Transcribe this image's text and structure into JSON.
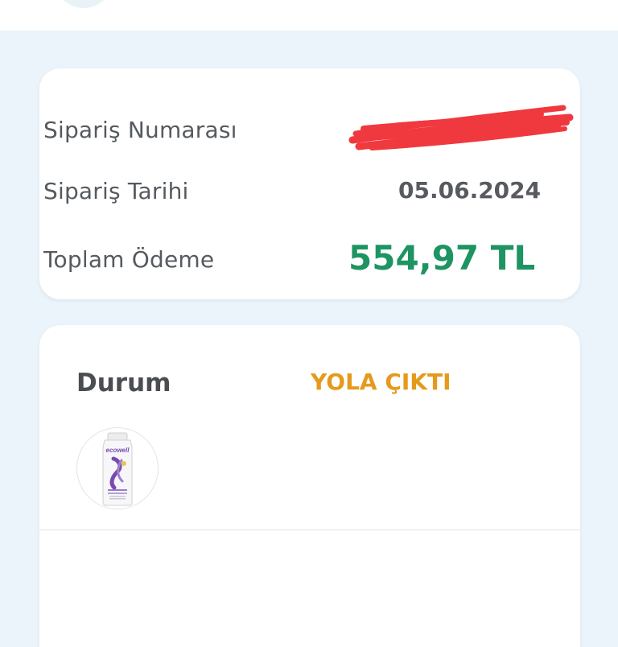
{
  "summary": {
    "order_number_label": "Sipariş Numarası",
    "order_date_label": "Sipariş Tarihi",
    "order_date_value": "05.06.2024",
    "total_label": "Toplam Ödeme",
    "total_value": "554,97 TL"
  },
  "status": {
    "label": "Durum",
    "value": "YOLA ÇIKTI"
  },
  "product": {
    "brand": "ecowell",
    "icon": "shampoo-bottle-icon"
  },
  "colors": {
    "page_background": "#eaf4fa",
    "total_green": "#1e9462",
    "status_orange": "#e59a1c",
    "redaction_red": "#f0393f",
    "product_purple": "#7a4ab0"
  }
}
